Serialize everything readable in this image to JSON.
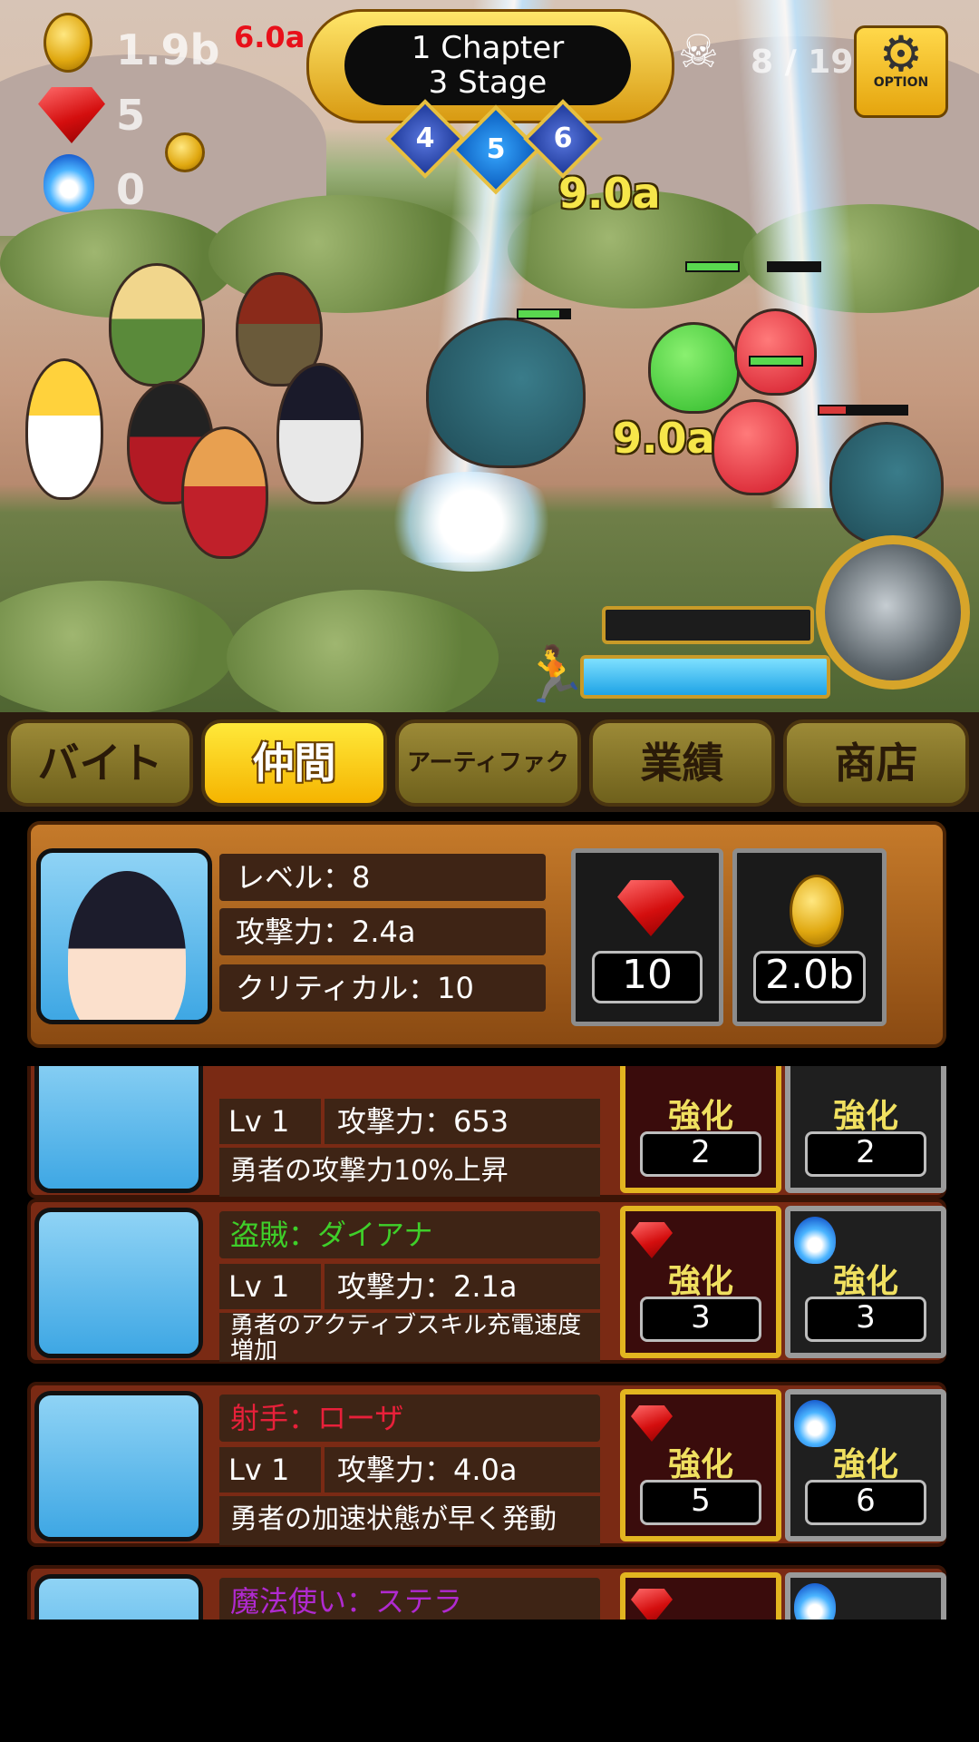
{
  "hud": {
    "gold": "1.9b",
    "gold_rate": "6.0a",
    "rubies": "5",
    "souls": "0",
    "kills": "8 / 19",
    "colors": {
      "gold_rate": "#e8101a",
      "damage": "#f6e64a"
    }
  },
  "stage": {
    "chapter": "1 Chapter",
    "stage": "3 Stage",
    "selector": [
      "4",
      "5",
      "6"
    ],
    "selected": "5"
  },
  "option_button": {
    "label": "OPTION"
  },
  "damage_popups": [
    "9.0a",
    "9.0a"
  ],
  "tabs": [
    {
      "label": "バイト",
      "active": false
    },
    {
      "label": "仲間",
      "active": true
    },
    {
      "label": "アーティファクト",
      "active": false
    },
    {
      "label": "業績",
      "active": false
    },
    {
      "label": "商店",
      "active": false
    }
  ],
  "hero": {
    "level": "レベル：8",
    "attack": "攻撃力：2.4a",
    "critical": "クリティカル：10",
    "ruby_cost": "10",
    "gold_cost": "2.0b"
  },
  "upgrade_label": "強化",
  "allies": [
    {
      "name": "",
      "lv": "Lv 1",
      "atk": "攻撃力：653",
      "desc": "勇者の攻撃力10%上昇",
      "cost_a": "2",
      "cost_b": "2"
    },
    {
      "name": "盗賊：ダイアナ",
      "name_color": "#3fcf2a",
      "lv": "Lv 1",
      "atk": "攻撃力：2.1a",
      "desc": "勇者のアクティブスキル充電速度増加",
      "cost_a": "3",
      "cost_b": "3"
    },
    {
      "name": "射手：ローザ",
      "name_color": "#e8203a",
      "lv": "Lv 1",
      "atk": "攻撃力：4.0a",
      "desc": "勇者の加速状態が早く発動",
      "cost_a": "5",
      "cost_b": "6"
    },
    {
      "name": "魔法使い：ステラ",
      "name_color": "#b02ad0"
    }
  ]
}
